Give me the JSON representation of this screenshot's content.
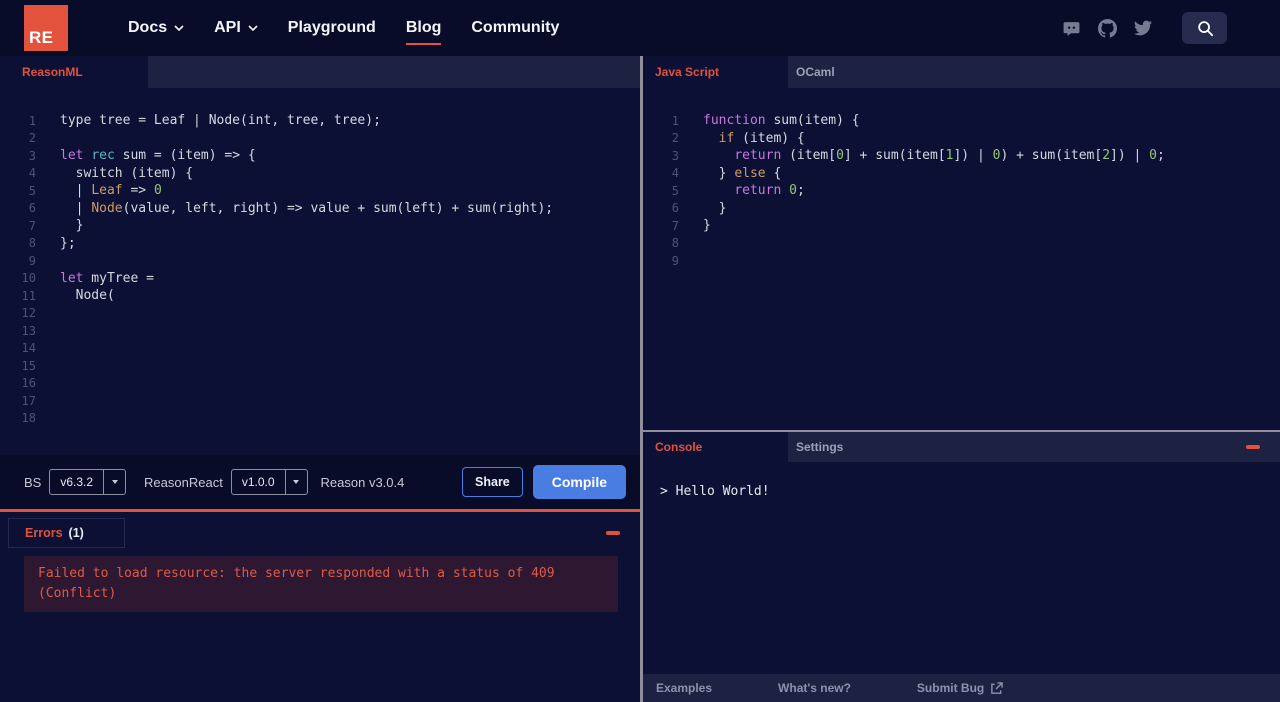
{
  "navbar": {
    "logo_text": "RE",
    "items": [
      {
        "label": "Docs",
        "chevron": true,
        "active": false
      },
      {
        "label": "API",
        "chevron": true,
        "active": false
      },
      {
        "label": "Playground",
        "chevron": false,
        "active": false
      },
      {
        "label": "Blog",
        "chevron": false,
        "active": true
      },
      {
        "label": "Community",
        "chevron": false,
        "active": false
      }
    ],
    "icon_names": [
      "discord-icon",
      "github-icon",
      "twitter-icon",
      "search-icon"
    ]
  },
  "left_panel": {
    "tab_label": "ReasonML",
    "code_lines": [
      [
        [
          "plain",
          "type tree = Leaf | Node(int, tree, tree);"
        ]
      ],
      [],
      [
        [
          "kw",
          "let"
        ],
        [
          "plain",
          " "
        ],
        [
          "kw2",
          "rec"
        ],
        [
          "plain",
          " sum = (item) => {"
        ]
      ],
      [
        [
          "plain",
          "  switch (item) {"
        ]
      ],
      [
        [
          "plain",
          "  | "
        ],
        [
          "ctor",
          "Leaf"
        ],
        [
          "plain",
          " => "
        ],
        [
          "num",
          "0"
        ]
      ],
      [
        [
          "plain",
          "  | "
        ],
        [
          "ctor",
          "Node"
        ],
        [
          "plain",
          "(value, left, right) => value + sum(left) + sum(right);"
        ]
      ],
      [
        [
          "plain",
          "  }"
        ]
      ],
      [
        [
          "plain",
          "};"
        ]
      ],
      [],
      [
        [
          "kw",
          "let"
        ],
        [
          "plain",
          " myTree ="
        ]
      ],
      [
        [
          "plain",
          "  Node("
        ]
      ],
      [],
      [],
      [],
      [],
      [],
      [],
      []
    ],
    "toolbar": {
      "bs_label": "BS",
      "bs_version": "v6.3.2",
      "reasonreact_label": "ReasonReact",
      "reasonreact_version": "v1.0.0",
      "reason_version": "Reason v3.0.4",
      "share_label": "Share",
      "compile_label": "Compile"
    },
    "errors": {
      "title": "Errors",
      "count": "(1)",
      "message": "Failed to load resource: the server responded with a status of 409 (Conflict)"
    }
  },
  "right_panel": {
    "tabs": [
      {
        "label": "Java Script",
        "active": true
      },
      {
        "label": "OCaml",
        "active": false
      }
    ],
    "code_lines": [
      [
        [
          "kw",
          "function"
        ],
        [
          "plain",
          " sum(item) {"
        ]
      ],
      [
        [
          "plain",
          "  "
        ],
        [
          "ctor",
          "if"
        ],
        [
          "plain",
          " (item) {"
        ]
      ],
      [
        [
          "plain",
          "    "
        ],
        [
          "kw",
          "return"
        ],
        [
          "plain",
          " (item["
        ],
        [
          "num",
          "0"
        ],
        [
          "plain",
          "] + sum(item["
        ],
        [
          "num",
          "1"
        ],
        [
          "plain",
          "]) | "
        ],
        [
          "num",
          "0"
        ],
        [
          "plain",
          ") + sum(item["
        ],
        [
          "num",
          "2"
        ],
        [
          "plain",
          "]) | "
        ],
        [
          "num",
          "0"
        ],
        [
          "plain",
          ";"
        ]
      ],
      [
        [
          "plain",
          "  } "
        ],
        [
          "ctor",
          "else"
        ],
        [
          "plain",
          " {"
        ]
      ],
      [
        [
          "plain",
          "    "
        ],
        [
          "kw",
          "return"
        ],
        [
          "plain",
          " "
        ],
        [
          "num",
          "0"
        ],
        [
          "plain",
          ";"
        ]
      ],
      [
        [
          "plain",
          "  }"
        ]
      ],
      [
        [
          "plain",
          "}"
        ]
      ],
      [],
      []
    ],
    "console": {
      "tabs": [
        {
          "label": "Console",
          "active": true
        },
        {
          "label": "Settings",
          "active": false
        }
      ],
      "output": "> Hello World!"
    },
    "footer_links": [
      "Examples",
      "What's new?",
      "Submit Bug"
    ]
  },
  "colors": {
    "accent": "#e1523d",
    "button_blue": "#4a7de2",
    "error_text": "#dd5b49",
    "error_bg": "#2e1731",
    "editor_bg": "#0c1034",
    "tabbar_bg": "#1e2242",
    "navbar_bg": "#090c28"
  }
}
